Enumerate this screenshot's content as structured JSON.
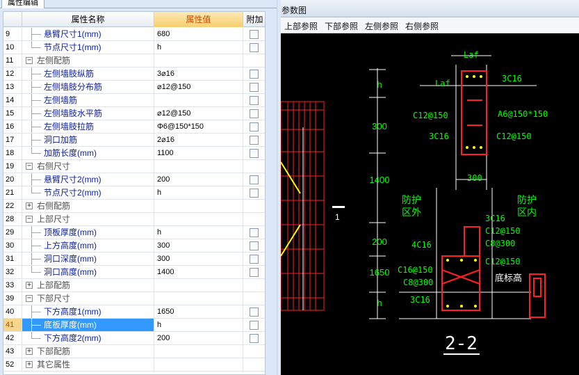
{
  "property_panel": {
    "tab_label": "属性编辑",
    "columns": {
      "name": "属性名称",
      "value": "属性值",
      "extra": "附加"
    },
    "rows": [
      {
        "num": "9",
        "name": "悬臂尺寸1(mm)",
        "value": "680",
        "type": "leaf",
        "expand": "",
        "checkbox": true,
        "last": false,
        "selected": false
      },
      {
        "num": "10",
        "name": "节点尺寸1(mm)",
        "value": "h",
        "type": "leaf",
        "expand": "",
        "checkbox": true,
        "last": true,
        "selected": false
      },
      {
        "num": "11",
        "name": "左侧配筋",
        "value": "",
        "type": "group",
        "expand": "−",
        "checkbox": false,
        "last": false,
        "selected": false
      },
      {
        "num": "12",
        "name": "左侧墙肢纵筋",
        "value": "3⌀16",
        "type": "leaf",
        "expand": "",
        "checkbox": true,
        "last": false,
        "selected": false
      },
      {
        "num": "13",
        "name": "左侧墙肢分布筋",
        "value": "⌀12@150",
        "type": "leaf",
        "expand": "",
        "checkbox": true,
        "last": false,
        "selected": false
      },
      {
        "num": "14",
        "name": "左侧墙筋",
        "value": "",
        "type": "leaf",
        "expand": "",
        "checkbox": true,
        "last": false,
        "selected": false
      },
      {
        "num": "15",
        "name": "左侧墙肢水平筋",
        "value": "⌀12@150",
        "type": "leaf",
        "expand": "",
        "checkbox": true,
        "last": false,
        "selected": false
      },
      {
        "num": "16",
        "name": "左侧墙肢拉筋",
        "value": "Φ6@150*150",
        "type": "leaf",
        "expand": "",
        "checkbox": true,
        "last": false,
        "selected": false
      },
      {
        "num": "17",
        "name": "洞口加筋",
        "value": "2⌀16",
        "type": "leaf",
        "expand": "",
        "checkbox": true,
        "last": false,
        "selected": false
      },
      {
        "num": "18",
        "name": "加筋长度(mm)",
        "value": "1100",
        "type": "leaf",
        "expand": "",
        "checkbox": true,
        "last": true,
        "selected": false
      },
      {
        "num": "19",
        "name": "右侧尺寸",
        "value": "",
        "type": "group",
        "expand": "−",
        "checkbox": false,
        "last": false,
        "selected": false
      },
      {
        "num": "20",
        "name": "悬臂尺寸2(mm)",
        "value": "200",
        "type": "leaf",
        "expand": "",
        "checkbox": true,
        "last": false,
        "selected": false
      },
      {
        "num": "21",
        "name": "节点尺寸2(mm)",
        "value": "h",
        "type": "leaf",
        "expand": "",
        "checkbox": true,
        "last": true,
        "selected": false
      },
      {
        "num": "22",
        "name": "右侧配筋",
        "value": "",
        "type": "group",
        "expand": "+",
        "checkbox": false,
        "last": false,
        "selected": false
      },
      {
        "num": "28",
        "name": "上部尺寸",
        "value": "",
        "type": "group",
        "expand": "−",
        "checkbox": false,
        "last": false,
        "selected": false
      },
      {
        "num": "29",
        "name": "顶板厚度(mm)",
        "value": "h",
        "type": "leaf",
        "expand": "",
        "checkbox": true,
        "last": false,
        "selected": false
      },
      {
        "num": "30",
        "name": "上方高度(mm)",
        "value": "300",
        "type": "leaf",
        "expand": "",
        "checkbox": true,
        "last": false,
        "selected": false
      },
      {
        "num": "31",
        "name": "洞口深度(mm)",
        "value": "300",
        "type": "leaf",
        "expand": "",
        "checkbox": true,
        "last": false,
        "selected": false
      },
      {
        "num": "32",
        "name": "洞口高度(mm)",
        "value": "1400",
        "type": "leaf",
        "expand": "",
        "checkbox": true,
        "last": true,
        "selected": false
      },
      {
        "num": "33",
        "name": "上部配筋",
        "value": "",
        "type": "group",
        "expand": "+",
        "checkbox": false,
        "last": false,
        "selected": false
      },
      {
        "num": "39",
        "name": "下部尺寸",
        "value": "",
        "type": "group",
        "expand": "−",
        "checkbox": false,
        "last": false,
        "selected": false
      },
      {
        "num": "40",
        "name": "下方高度1(mm)",
        "value": "1650",
        "type": "leaf",
        "expand": "",
        "checkbox": true,
        "last": false,
        "selected": false
      },
      {
        "num": "41",
        "name": "底板厚度(mm)",
        "value": "h",
        "type": "leaf",
        "expand": "",
        "checkbox": true,
        "last": false,
        "selected": true
      },
      {
        "num": "42",
        "name": "下方高度2(mm)",
        "value": "200",
        "type": "leaf",
        "expand": "",
        "checkbox": true,
        "last": true,
        "selected": false
      },
      {
        "num": "43",
        "name": "下部配筋",
        "value": "",
        "type": "group",
        "expand": "+",
        "checkbox": false,
        "last": false,
        "selected": false
      },
      {
        "num": "52",
        "name": "其它属性",
        "value": "",
        "type": "group",
        "expand": "+",
        "checkbox": false,
        "last": false,
        "selected": false
      }
    ]
  },
  "reference_panel": {
    "title": "参数图",
    "toolbar": [
      "上部参照",
      "下部参照",
      "左侧参照",
      "右侧参照"
    ],
    "drawing": {
      "section_label": "2-2",
      "side_marker": "1",
      "dims_vertical": [
        "h",
        "300",
        "1400",
        "200",
        "1650",
        "h"
      ],
      "dim_top": "Laf",
      "dim_left_top": "Laf",
      "dim_mid": "300",
      "labels_top": [
        "3C16",
        "C12@150",
        "A6@150*150",
        "3C16",
        "C12@150"
      ],
      "zone_outside": [
        "防护",
        "区外"
      ],
      "zone_inside": [
        "防护",
        "区内"
      ],
      "labels_bottom": [
        "3C16",
        "C12@150",
        "C8@300",
        "4C16",
        "C12@150",
        "C16@150",
        "C8@300",
        "3C16"
      ],
      "bottom_elev_label": "底标高",
      "colors": {
        "rebar": "#ff2020",
        "annotation": "#00ff00",
        "dimension": "#ffffff",
        "hatch_yellow": "#ffff00"
      }
    }
  }
}
